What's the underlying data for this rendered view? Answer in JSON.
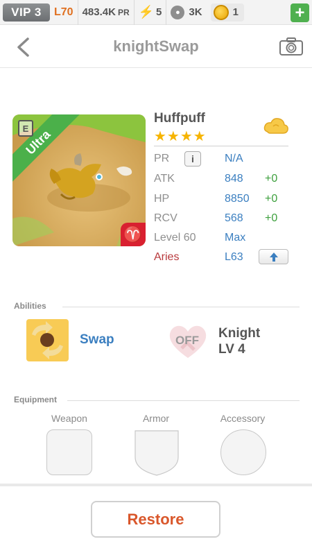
{
  "status_bar": {
    "vip": "VIP 3",
    "level": "L70",
    "power_value": "483.4K",
    "power_unit": "PR",
    "energy": "5",
    "pets": "3K",
    "coins": "1",
    "add_label": "+"
  },
  "header": {
    "title": "knightSwap"
  },
  "card": {
    "rarity": "Ultra",
    "doc_letter": "E",
    "sign_glyph": "♈"
  },
  "creature": {
    "name": "Huffpuff",
    "stars": "★★★★",
    "star_count": 4,
    "info_glyph": "i",
    "stats": [
      {
        "label": "PR",
        "value": "N/A",
        "bonus": ""
      },
      {
        "label": "ATK",
        "value": "848",
        "bonus": "+0"
      },
      {
        "label": "HP",
        "value": "8850",
        "bonus": "+0"
      },
      {
        "label": "RCV",
        "value": "568",
        "bonus": "+0"
      },
      {
        "label": "Level 60",
        "value": "Max",
        "bonus": ""
      },
      {
        "label": "Aries",
        "value": "L63",
        "bonus": ""
      }
    ]
  },
  "abilities": {
    "title": "Abilities",
    "swap_label": "Swap",
    "off_label": "OFF",
    "knight_name": "Knight",
    "knight_level": "LV 4"
  },
  "equipment": {
    "title": "Equipment",
    "weapon": "Weapon",
    "armor": "Armor",
    "accessory": "Accessory"
  },
  "restore_label": "Restore",
  "colors": {
    "accent_blue": "#3b7fc0",
    "bonus_green": "#3ea03e",
    "restore_orange": "#d9572b",
    "aries_red": "#b8393c",
    "ultra_green": "#4bb04a"
  }
}
